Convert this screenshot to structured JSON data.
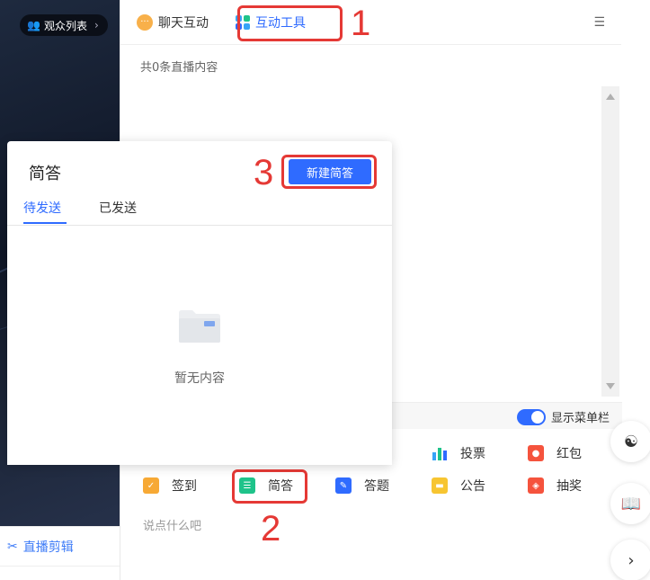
{
  "left": {
    "audience_label": "观众列表",
    "edit_label": "直播剪辑"
  },
  "tabs": [
    {
      "label": "聊天互动"
    },
    {
      "label": "互动工具"
    }
  ],
  "main": {
    "count_text": "共0条直播内容",
    "show_menu_label": "显示菜单栏",
    "input_placeholder": "说点什么吧"
  },
  "tools": [
    {
      "label": "投票",
      "icon": "vote-icon",
      "color": "#36a3f7"
    },
    {
      "label": "红包",
      "icon": "redpacket-icon",
      "color": "#f5533d"
    },
    {
      "label": "签到",
      "icon": "checkin-icon",
      "color": "#f7a935"
    },
    {
      "label": "简答",
      "icon": "brief-answer-icon",
      "color": "#1ec38a"
    },
    {
      "label": "答题",
      "icon": "quiz-icon",
      "color": "#2f6bff"
    },
    {
      "label": "公告",
      "icon": "notice-icon",
      "color": "#f7c531"
    },
    {
      "label": "抽奖",
      "icon": "lottery-icon",
      "color": "#f5533d"
    }
  ],
  "popup": {
    "title": "简答",
    "new_button": "新建简答",
    "tab_pending": "待发送",
    "tab_sent": "已发送",
    "empty_text": "暂无内容"
  },
  "annotations": [
    "1",
    "2",
    "3"
  ]
}
